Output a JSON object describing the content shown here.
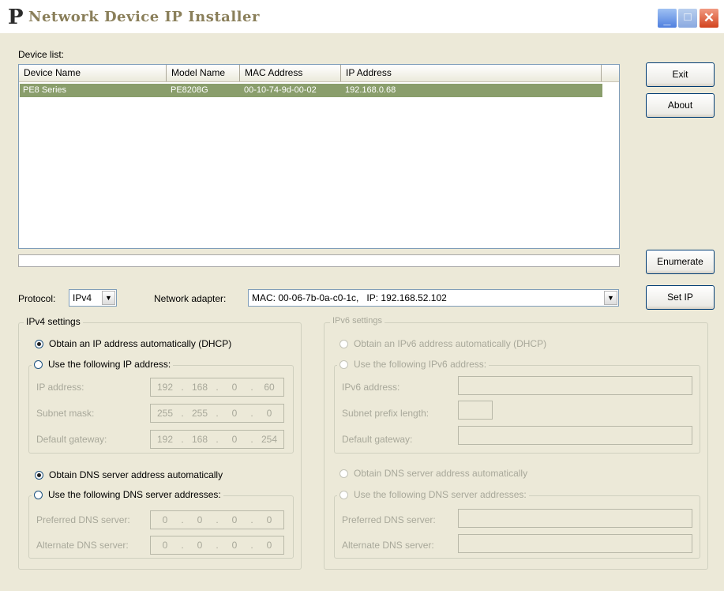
{
  "window": {
    "title": "Network Device IP Installer",
    "logo": "P",
    "controls": {
      "minimize": "_",
      "maximize": "□",
      "close": "✕"
    }
  },
  "device_list": {
    "label": "Device list:",
    "columns": [
      "Device Name",
      "Model Name",
      "MAC Address",
      "IP Address"
    ],
    "rows": [
      {
        "device_name": "PE8 Series",
        "model_name": "PE8208G",
        "mac": "00-10-74-9d-00-02",
        "ip": "192.168.0.68"
      }
    ]
  },
  "buttons": {
    "exit": "Exit",
    "about": "About",
    "enumerate": "Enumerate",
    "set_ip": "Set IP"
  },
  "protocol": {
    "label": "Protocol:",
    "value": "IPv4"
  },
  "network_adapter": {
    "label": "Network adapter:",
    "value": "MAC: 00-06-7b-0a-c0-1c,   IP: 192.168.52.102"
  },
  "ipv4": {
    "group_title": "IPv4 settings",
    "dhcp_label": "Obtain an IP address automatically (DHCP)",
    "dhcp_selected": true,
    "static_label": "Use the following IP address:",
    "ip_label": "IP address:",
    "ip_value": [
      "192",
      "168",
      "0",
      "60"
    ],
    "mask_label": "Subnet mask:",
    "mask_value": [
      "255",
      "255",
      "0",
      "0"
    ],
    "gateway_label": "Default gateway:",
    "gateway_value": [
      "192",
      "168",
      "0",
      "254"
    ],
    "dns_auto_label": "Obtain DNS server address automatically",
    "dns_auto_selected": true,
    "dns_static_label": "Use the following DNS server addresses:",
    "preferred_dns_label": "Preferred DNS server:",
    "preferred_dns_value": [
      "0",
      "0",
      "0",
      "0"
    ],
    "alternate_dns_label": "Alternate DNS server:",
    "alternate_dns_value": [
      "0",
      "0",
      "0",
      "0"
    ]
  },
  "ipv6": {
    "group_title": "IPv6 settings",
    "dhcp_label": "Obtain an IPv6 address automatically (DHCP)",
    "static_label": "Use the following IPv6 address:",
    "ip_label": "IPv6 address:",
    "prefix_label": "Subnet prefix length:",
    "gateway_label": "Default gateway:",
    "dns_auto_label": "Obtain DNS server address automatically",
    "dns_static_label": "Use the following DNS server addresses:",
    "preferred_dns_label": "Preferred DNS server:",
    "alternate_dns_label": "Alternate DNS server:"
  },
  "colors": {
    "selected_row": "#8a9e6c",
    "window_bg": "#ece9d8",
    "disabled_text": "#a8a89a"
  }
}
